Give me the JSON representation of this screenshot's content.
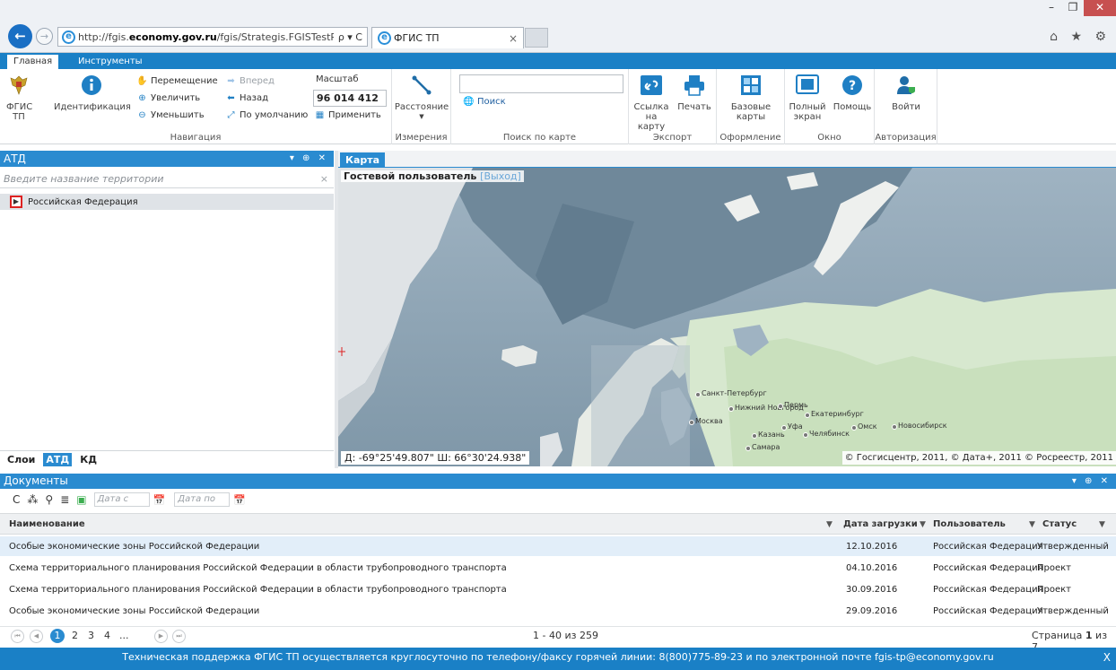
{
  "browser": {
    "window_buttons": {
      "minimize": "–",
      "maximize": "❐",
      "close": "✕"
    },
    "back_glyph": "←",
    "forward_glyph": "→",
    "url_prefix": "http://fgis.",
    "url_domain": "economy.gov.ru",
    "url_suffix": "/fgis/Strategis.FGISTestPageFGI",
    "addr_tools": "ρ ▾ C",
    "tab_title": "ФГИС ТП",
    "tab_close": "×",
    "right_icons": "⌂ ★ ⚙"
  },
  "ribbon_tabs": [
    "Главная",
    "Инструменты"
  ],
  "ribbon": {
    "fgis": "ФГИС ТП",
    "identify": "Идентификация",
    "nav": {
      "pan": "Перемещение",
      "forward": "Вперед",
      "zoom_in": "Увеличить",
      "back": "Назад",
      "zoom_out": "Уменьшить",
      "default": "По умолчанию",
      "group": "Навигация"
    },
    "scale": {
      "label": "Масштаб",
      "value": "96 014 412",
      "apply": "Применить"
    },
    "measure": {
      "distance": "Расстояние",
      "group": "Измерения"
    },
    "search": {
      "value": "",
      "button": "Поиск",
      "group": "Поиск по карте"
    },
    "export": {
      "link": "Ссылка на карту",
      "print": "Печать",
      "group": "Экспорт"
    },
    "design": {
      "basemaps": "Базовые карты",
      "group": "Оформление"
    },
    "window": {
      "fullscreen": "Полный экран",
      "help": "Помощь",
      "group": "Окно"
    },
    "auth": {
      "login": "Войти",
      "group": "Авторизация"
    }
  },
  "atd_panel": {
    "title": "АТД",
    "controls": "▾ ⊕ ✕",
    "search_placeholder": "Введите название территории",
    "search_clear": "×",
    "tree_toggle": "▶",
    "tree_root": "Российская Федерация",
    "tabs": [
      "Слои",
      "АТД",
      "КД"
    ]
  },
  "map_panel": {
    "tab": "Карта",
    "user": "Гостевой пользователь",
    "logout": "[Выход]",
    "coords": "Д: -69°25'49.807\"   Ш: 66°30'24.938\"",
    "copyright": "© Госгисцентр, 2011, © Дата+, 2011 © Росреестр, 2011",
    "cities": [
      "Санкт-Петербург",
      "Нижний Новгород",
      "Москва",
      "Казань",
      "Пермь",
      "Екатеринбург",
      "Уфа",
      "Челябинск",
      "Омск",
      "Новосибирск",
      "Самара"
    ]
  },
  "docs_panel": {
    "title": "Документы",
    "controls": "▾ ⊕ ✕",
    "toolbar_icons": [
      "C",
      "⁂",
      "⚲",
      "≣",
      "▣"
    ],
    "date_from": "Дата с",
    "date_to": "Дата по",
    "cal_glyph": "📅",
    "filter_glyph": "▼",
    "columns": [
      "Наименование",
      "Дата загрузки",
      "Пользователь",
      "Статус"
    ],
    "rows": [
      {
        "name": "Особые экономические зоны Российской Федерации",
        "date": "12.10.2016",
        "user": "Российская Федерация",
        "status": "Утвержденный"
      },
      {
        "name": "Схема территориального планирования Российской Федерации в области трубопроводного транспорта",
        "date": "04.10.2016",
        "user": "Российская Федерация",
        "status": "Проект"
      },
      {
        "name": "Схема территориального планирования Российской Федерации в области трубопроводного транспорта",
        "date": "30.09.2016",
        "user": "Российская Федерация",
        "status": "Проект"
      },
      {
        "name": "Особые экономические зоны Российской Федерации",
        "date": "29.09.2016",
        "user": "Российская Федерация",
        "status": "Утвержденный"
      }
    ],
    "pager": {
      "first": "⏮",
      "prev": "◀",
      "pages": [
        "1",
        "2",
        "3",
        "4",
        "..."
      ],
      "next": "▶",
      "last": "⏭",
      "range": "1 - 40 из 259",
      "page_label": "Страница",
      "page_current": "1",
      "page_of": "из 7"
    }
  },
  "footer": {
    "text": "Техническая поддержка ФГИС ТП осуществляется круглосуточно по телефону/факсу горячей линии: 8(800)775-89-23 и по электронной почте fgis-tp@economy.gov.ru",
    "close": "X"
  },
  "colors": {
    "accent": "#2a8bd0",
    "ribbon_tab_bar": "#1a80c6",
    "selected_row": "#e2eef9"
  }
}
